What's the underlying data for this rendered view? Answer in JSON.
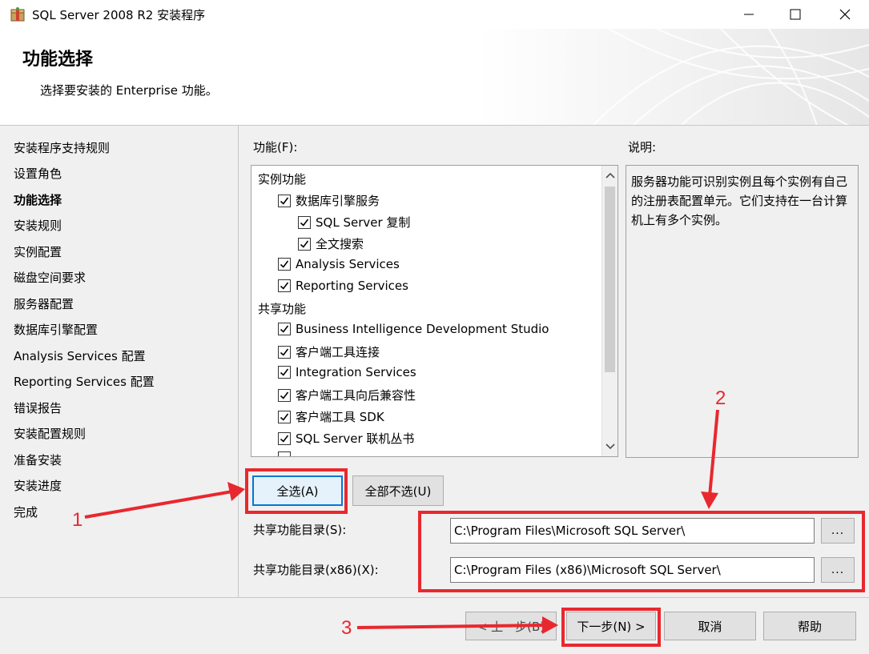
{
  "window": {
    "title": "SQL Server 2008 R2 安装程序",
    "minimize_icon": "minimize-icon",
    "maximize_icon": "maximize-icon",
    "close_icon": "close-icon"
  },
  "header": {
    "title": "功能选择",
    "subtitle": "选择要安装的 Enterprise 功能。"
  },
  "sidebar": {
    "items": [
      {
        "label": "安装程序支持规则",
        "active": false
      },
      {
        "label": "设置角色",
        "active": false
      },
      {
        "label": "功能选择",
        "active": true
      },
      {
        "label": "安装规则",
        "active": false
      },
      {
        "label": "实例配置",
        "active": false
      },
      {
        "label": "磁盘空间要求",
        "active": false
      },
      {
        "label": "服务器配置",
        "active": false
      },
      {
        "label": "数据库引擎配置",
        "active": false
      },
      {
        "label": "Analysis Services 配置",
        "active": false
      },
      {
        "label": "Reporting Services 配置",
        "active": false
      },
      {
        "label": "错误报告",
        "active": false
      },
      {
        "label": "安装配置规则",
        "active": false
      },
      {
        "label": "准备安装",
        "active": false
      },
      {
        "label": "安装进度",
        "active": false
      },
      {
        "label": "完成",
        "active": false
      }
    ]
  },
  "features": {
    "label": "功能(F):",
    "rows": [
      {
        "label": "实例功能",
        "level": 0,
        "checkbox": false
      },
      {
        "label": "数据库引擎服务",
        "level": 1,
        "checkbox": true,
        "checked": true
      },
      {
        "label": "SQL Server 复制",
        "level": 2,
        "checkbox": true,
        "checked": true
      },
      {
        "label": "全文搜索",
        "level": 2,
        "checkbox": true,
        "checked": true
      },
      {
        "label": "Analysis Services",
        "level": 1,
        "checkbox": true,
        "checked": true
      },
      {
        "label": "Reporting Services",
        "level": 1,
        "checkbox": true,
        "checked": true
      },
      {
        "label": "共享功能",
        "level": 0,
        "checkbox": false
      },
      {
        "label": "Business Intelligence Development Studio",
        "level": 1,
        "checkbox": true,
        "checked": true
      },
      {
        "label": "客户端工具连接",
        "level": 1,
        "checkbox": true,
        "checked": true
      },
      {
        "label": "Integration Services",
        "level": 1,
        "checkbox": true,
        "checked": true
      },
      {
        "label": "客户端工具向后兼容性",
        "level": 1,
        "checkbox": true,
        "checked": true
      },
      {
        "label": "客户端工具 SDK",
        "level": 1,
        "checkbox": true,
        "checked": true
      },
      {
        "label": "SQL Server 联机丛书",
        "level": 1,
        "checkbox": true,
        "checked": true
      }
    ]
  },
  "description": {
    "label": "说明:",
    "text": "服务器功能可识别实例且每个实例有自己的注册表配置单元。它们支持在一台计算机上有多个实例。"
  },
  "buttons": {
    "select_all": "全选(A)",
    "unselect_all": "全部不选(U)",
    "browse": "...",
    "back": "< 上一步(B)",
    "next": "下一步(N) >",
    "cancel": "取消",
    "help": "帮助"
  },
  "shared_dir": {
    "label": "共享功能目录(S):",
    "value": "C:\\Program Files\\Microsoft SQL Server\\"
  },
  "shared_dir_x86": {
    "label": "共享功能目录(x86)(X):",
    "value": "C:\\Program Files (x86)\\Microsoft SQL Server\\"
  },
  "annotations": {
    "color": "#e8282e",
    "num1": "1",
    "num2": "2",
    "num3": "3"
  }
}
